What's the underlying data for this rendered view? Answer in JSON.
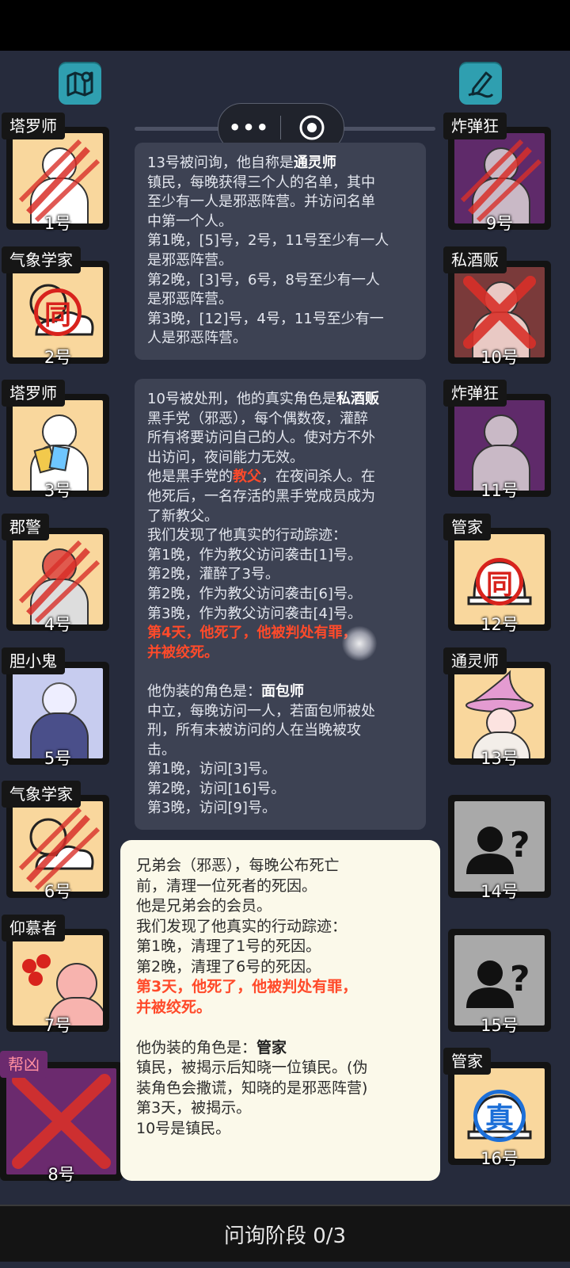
{
  "top_icons": {
    "left": "map-icon",
    "right": "edit-note-icon"
  },
  "capsule": {
    "more": "•••",
    "close": "record-icon"
  },
  "left_cards": [
    {
      "role": "塔罗师",
      "number": "1号"
    },
    {
      "role": "气象学家",
      "number": "2号"
    },
    {
      "role": "塔罗师",
      "number": "3号"
    },
    {
      "role": "郡警",
      "number": "4号"
    },
    {
      "role": "胆小鬼",
      "number": "5号"
    },
    {
      "role": "气象学家",
      "number": "6号"
    },
    {
      "role": "仰慕者",
      "number": "7号"
    },
    {
      "role": "帮凶",
      "number": "8号"
    }
  ],
  "right_cards": [
    {
      "role": "炸弹狂",
      "number": "9号"
    },
    {
      "role": "私酒贩",
      "number": "10号"
    },
    {
      "role": "炸弹狂",
      "number": "11号"
    },
    {
      "role": "管家",
      "number": "12号"
    },
    {
      "role": "通灵师",
      "number": "13号"
    },
    {
      "role": "",
      "number": "14号"
    },
    {
      "role": "",
      "number": "15号"
    },
    {
      "role": "管家",
      "number": "16号"
    }
  ],
  "stamps": {
    "same": "同",
    "real": "真"
  },
  "msg1": {
    "l1a": "13号被问询，他自称是",
    "l1b": "通灵师",
    "l2": "镇民，每晚获得三个人的名单，其中",
    "l3": "至少有一人是邪恶阵营。并访问名单",
    "l4": "中第一个人。",
    "l5": "第1晚，[5]号，2号，11号至少有一人",
    "l6": "是邪恶阵营。",
    "l7": "第2晚，[3]号，6号，8号至少有一人",
    "l8": "是邪恶阵营。",
    "l9": "第3晚，[12]号，4号，11号至少有一",
    "l10": "人是邪恶阵营。"
  },
  "msg2": {
    "l1a": "10号被处刑，他的真实角色是",
    "l1b": "私酒贩",
    "l2": "黑手党（邪恶），每个偶数夜，灌醉",
    "l3": "所有将要访问自己的人。使对方不外",
    "l4": "出访问，夜间能力无效。",
    "l5a": "他是黑手党的",
    "l5b": "教父",
    "l5c": "，在夜间杀人。在",
    "l6": "他死后，一名存活的黑手党成员成为",
    "l7": "了新教父。",
    "l8": "我们发现了他真实的行动踪迹：",
    "l9": "第1晚，作为教父访问袭击[1]号。",
    "l10": "第2晚，灌醉了3号。",
    "l11": "第2晚，作为教父访问袭击[6]号。",
    "l12": "第3晚，作为教父访问袭击[4]号。",
    "l13": "第4天，他死了，他被判处有罪，",
    "l14": "并被绞死。",
    "l15a": "他伪装的角色是：",
    "l15b": "面包师",
    "l16": "中立，每晚访问一人，若面包师被处",
    "l17": "刑，所有未被访问的人在当晚被攻",
    "l18": "击。",
    "l19": "第1晚，访问[3]号。",
    "l20": "第2晚，访问[16]号。",
    "l21": "第3晚，访问[9]号。"
  },
  "popup": {
    "l1": "兄弟会（邪恶），每晚公布死亡",
    "l2": "前，清理一位死者的死因。",
    "l3": "他是兄弟会的会员。",
    "l4": "我们发现了他真实的行动踪迹：",
    "l5": "第1晚，清理了1号的死因。",
    "l6": "第2晚，清理了6号的死因。",
    "l7": "第3天，他死了，他被判处有罪，",
    "l8": "并被绞死。",
    "l9a": "他伪装的角色是：",
    "l9b": "管家",
    "l10": "镇民，被揭示后知晓一位镇民。(伪",
    "l11": "装角色会撒谎，知晓的是邪恶阵营)",
    "l12": "第3天，被揭示。",
    "l13": "10号是镇民。"
  },
  "bottom": {
    "phase": "问询阶段 0/3"
  }
}
